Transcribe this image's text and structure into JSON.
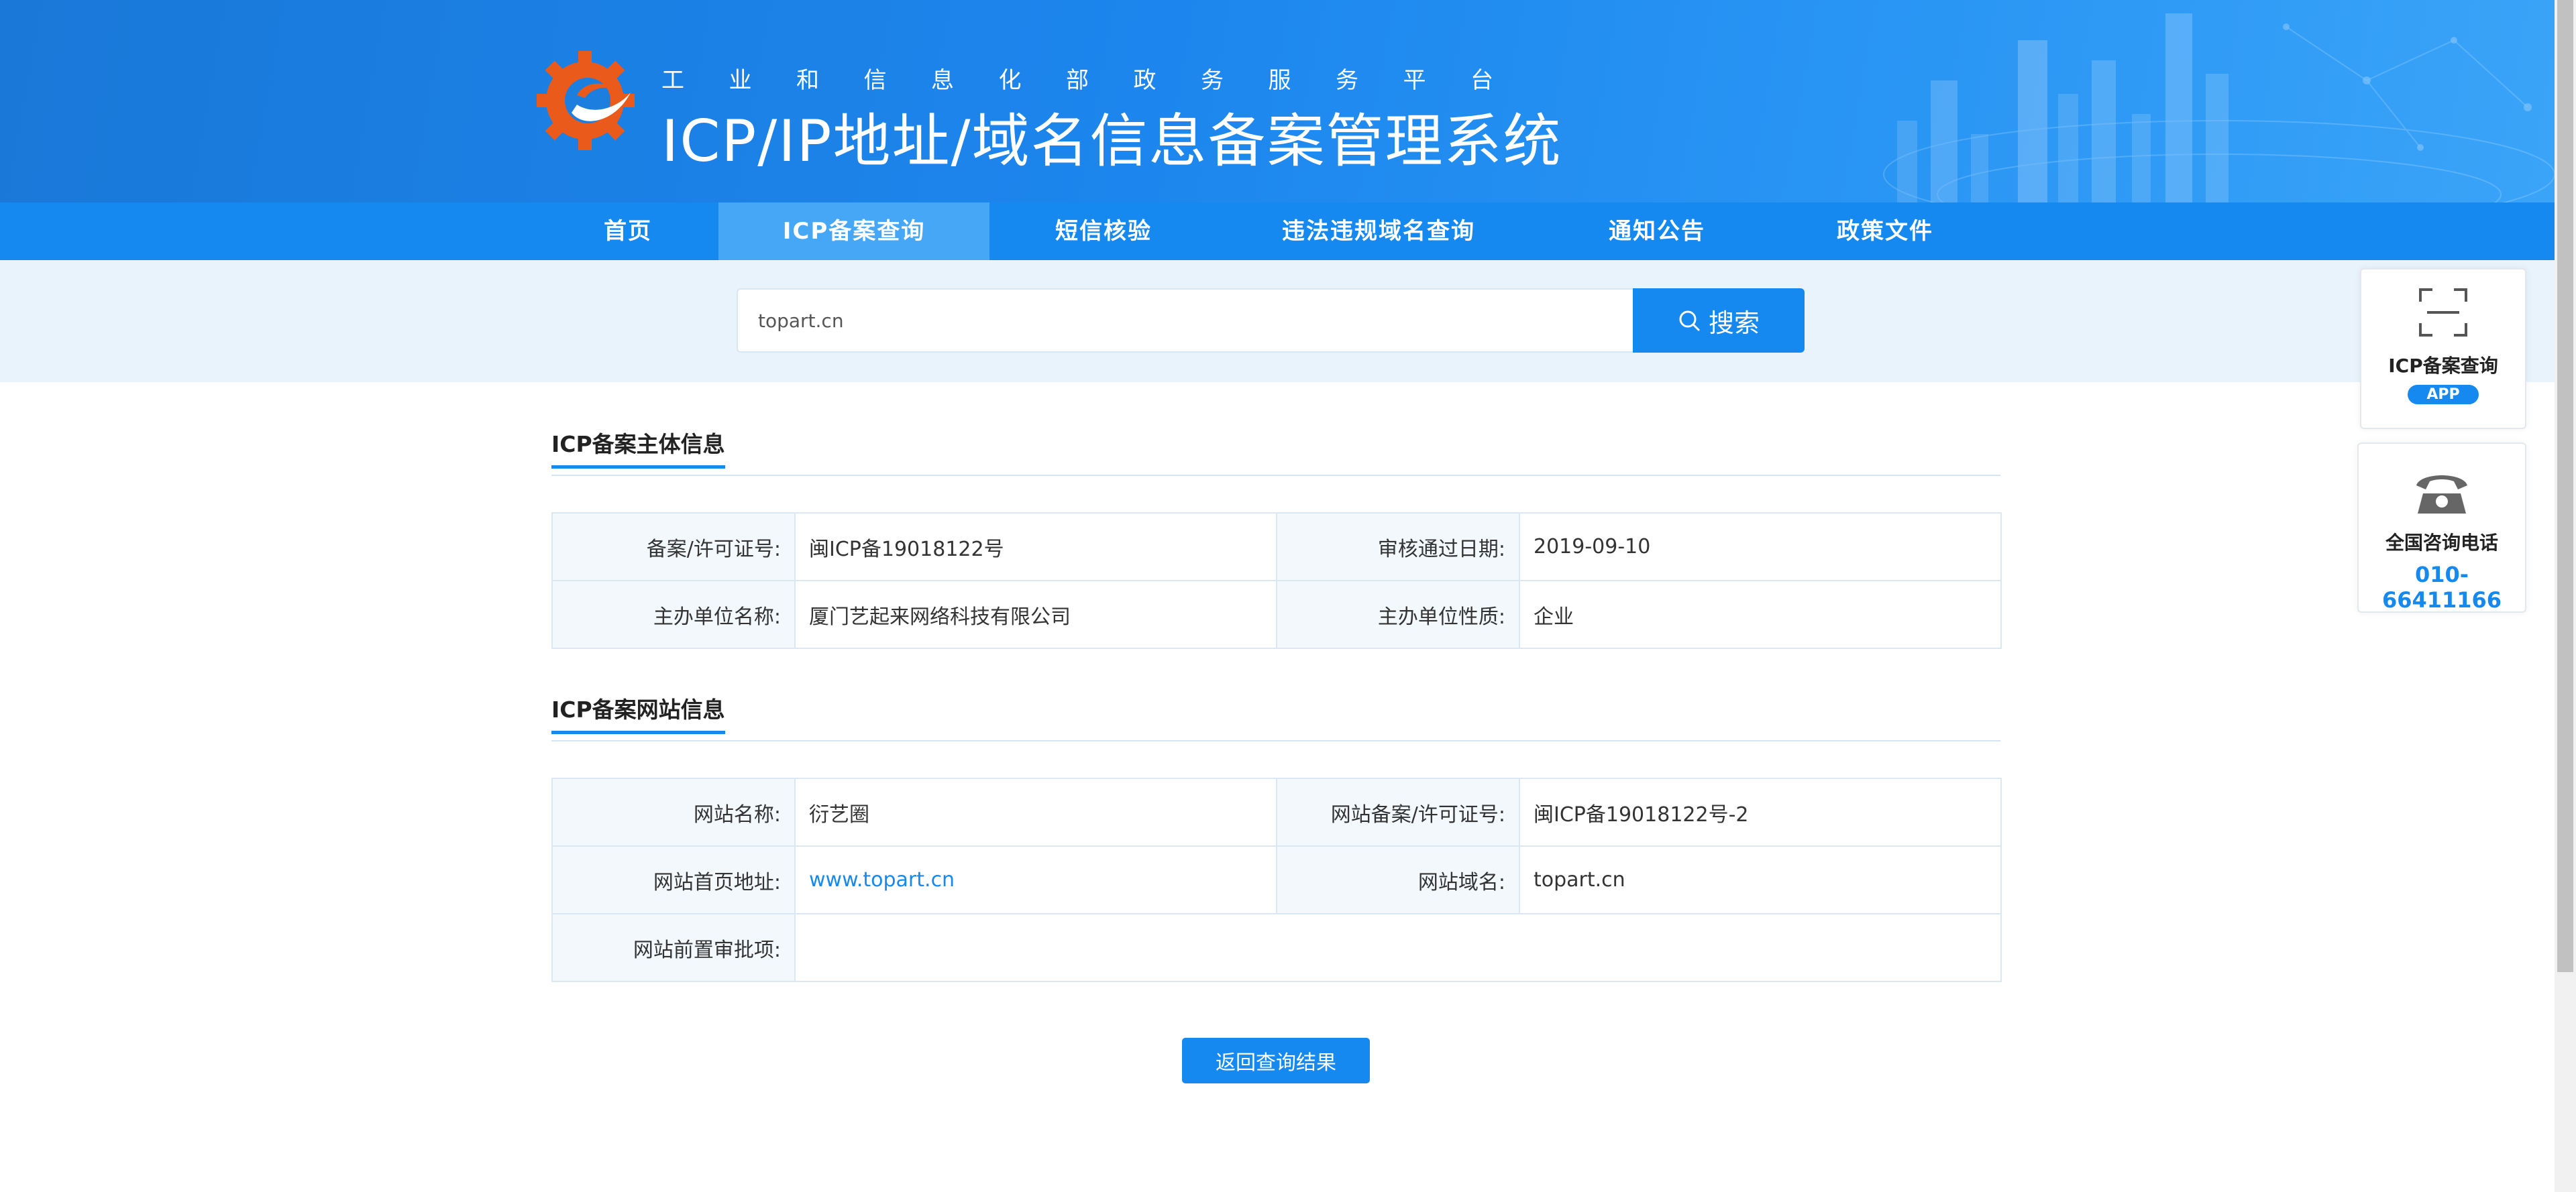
{
  "header": {
    "subtitle_chars": [
      "工",
      "业",
      "和",
      "信",
      "息",
      "化",
      "部",
      "政",
      "务",
      "服",
      "务",
      "平",
      "台"
    ],
    "title": "ICP/IP地址/域名信息备案管理系统"
  },
  "nav": {
    "items": [
      {
        "label": "首页",
        "active": false
      },
      {
        "label": "ICP备案查询",
        "active": true
      },
      {
        "label": "短信核验",
        "active": false
      },
      {
        "label": "违法违规域名查询",
        "active": false
      },
      {
        "label": "通知公告",
        "active": false
      },
      {
        "label": "政策文件",
        "active": false
      }
    ]
  },
  "search": {
    "value": "topart.cn",
    "button_label": "搜索"
  },
  "subject_section": {
    "title": "ICP备案主体信息",
    "rows": [
      [
        {
          "label": "备案/许可证号:",
          "value": "闽ICP备19018122号"
        },
        {
          "label": "审核通过日期:",
          "value": "2019-09-10"
        }
      ],
      [
        {
          "label": "主办单位名称:",
          "value": "厦门艺起来网络科技有限公司"
        },
        {
          "label": "主办单位性质:",
          "value": "企业"
        }
      ]
    ]
  },
  "website_section": {
    "title": "ICP备案网站信息",
    "rows": [
      [
        {
          "label": "网站名称:",
          "value": "衍艺圈"
        },
        {
          "label": "网站备案/许可证号:",
          "value": "闽ICP备19018122号-2"
        }
      ],
      [
        {
          "label": "网站首页地址:",
          "value": "www.topart.cn"
        },
        {
          "label": "网站域名:",
          "value": "topart.cn"
        }
      ],
      [
        {
          "label": "网站前置审批项:",
          "value": ""
        }
      ]
    ]
  },
  "back_button_label": "返回查询结果",
  "side": {
    "app_card_label": "ICP备案查询",
    "app_badge": "APP",
    "phone_card_label": "全国咨询电话",
    "phone_number": "010-66411166"
  },
  "colors": {
    "primary": "#1589f0",
    "nav_active": "#45a7f6",
    "search_band": "#e8f3fc",
    "label_cell": "#f3f8fd"
  }
}
